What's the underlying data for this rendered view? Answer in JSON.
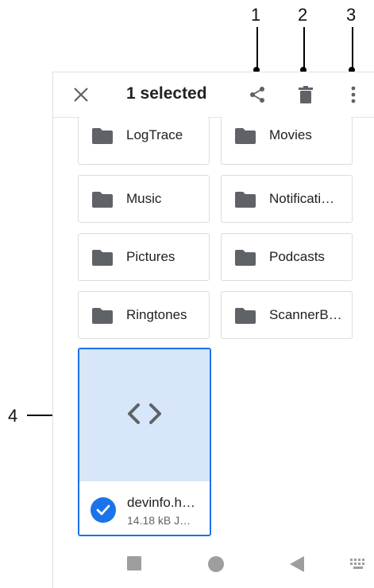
{
  "callouts": [
    "1",
    "2",
    "3",
    "4"
  ],
  "appbar": {
    "title": "1 selected",
    "close_icon": "close-icon",
    "share_icon": "share-icon",
    "delete_icon": "trash-icon",
    "more_icon": "more-vert-icon"
  },
  "folders": [
    {
      "name": "LogTrace"
    },
    {
      "name": "Movies"
    },
    {
      "name": "Music"
    },
    {
      "name": "Notificati…"
    },
    {
      "name": "Pictures"
    },
    {
      "name": "Podcasts"
    },
    {
      "name": "Ringtones"
    },
    {
      "name": "ScannerB…"
    }
  ],
  "file": {
    "name": "devinfo.h…",
    "details": "14.18 kB J…",
    "thumb_icon": "code-icon",
    "selected": true
  },
  "navbar": {
    "recents_icon": "square-icon",
    "home_icon": "circle-icon",
    "back_icon": "back-triangle-icon",
    "keyboard_icon": "keyboard-icon"
  },
  "colors": {
    "accent": "#1a73e8",
    "thumb_bg": "#d7e6f8",
    "icon_grey": "#5f6368"
  }
}
